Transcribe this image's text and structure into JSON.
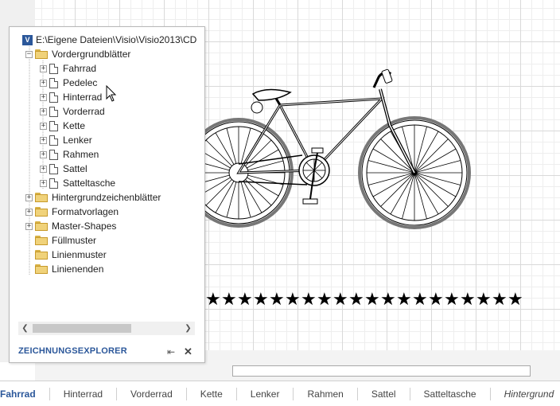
{
  "explorer": {
    "root_path": "E:\\Eigene Dateien\\Visio\\Visio2013\\CD",
    "footer_title": "ZEICHNUNGSEXPLORER",
    "foreground_label": "Vordergrundblätter",
    "pages": [
      "Fahrrad",
      "Pedelec",
      "Hinterrad",
      "Vorderrad",
      "Kette",
      "Lenker",
      "Rahmen",
      "Sattel",
      "Satteltasche"
    ],
    "folders": [
      "Hintergrundzeichenblätter",
      "Formatvorlagen",
      "Master-Shapes",
      "Füllmuster",
      "Linienmuster",
      "Linienenden"
    ]
  },
  "tabs": [
    "Fahrrad",
    "Hinterrad",
    "Vorderrad",
    "Kette",
    "Lenker",
    "Rahmen",
    "Sattel",
    "Satteltasche",
    "Hintergrund"
  ],
  "drawing": {
    "star_count": 20
  }
}
